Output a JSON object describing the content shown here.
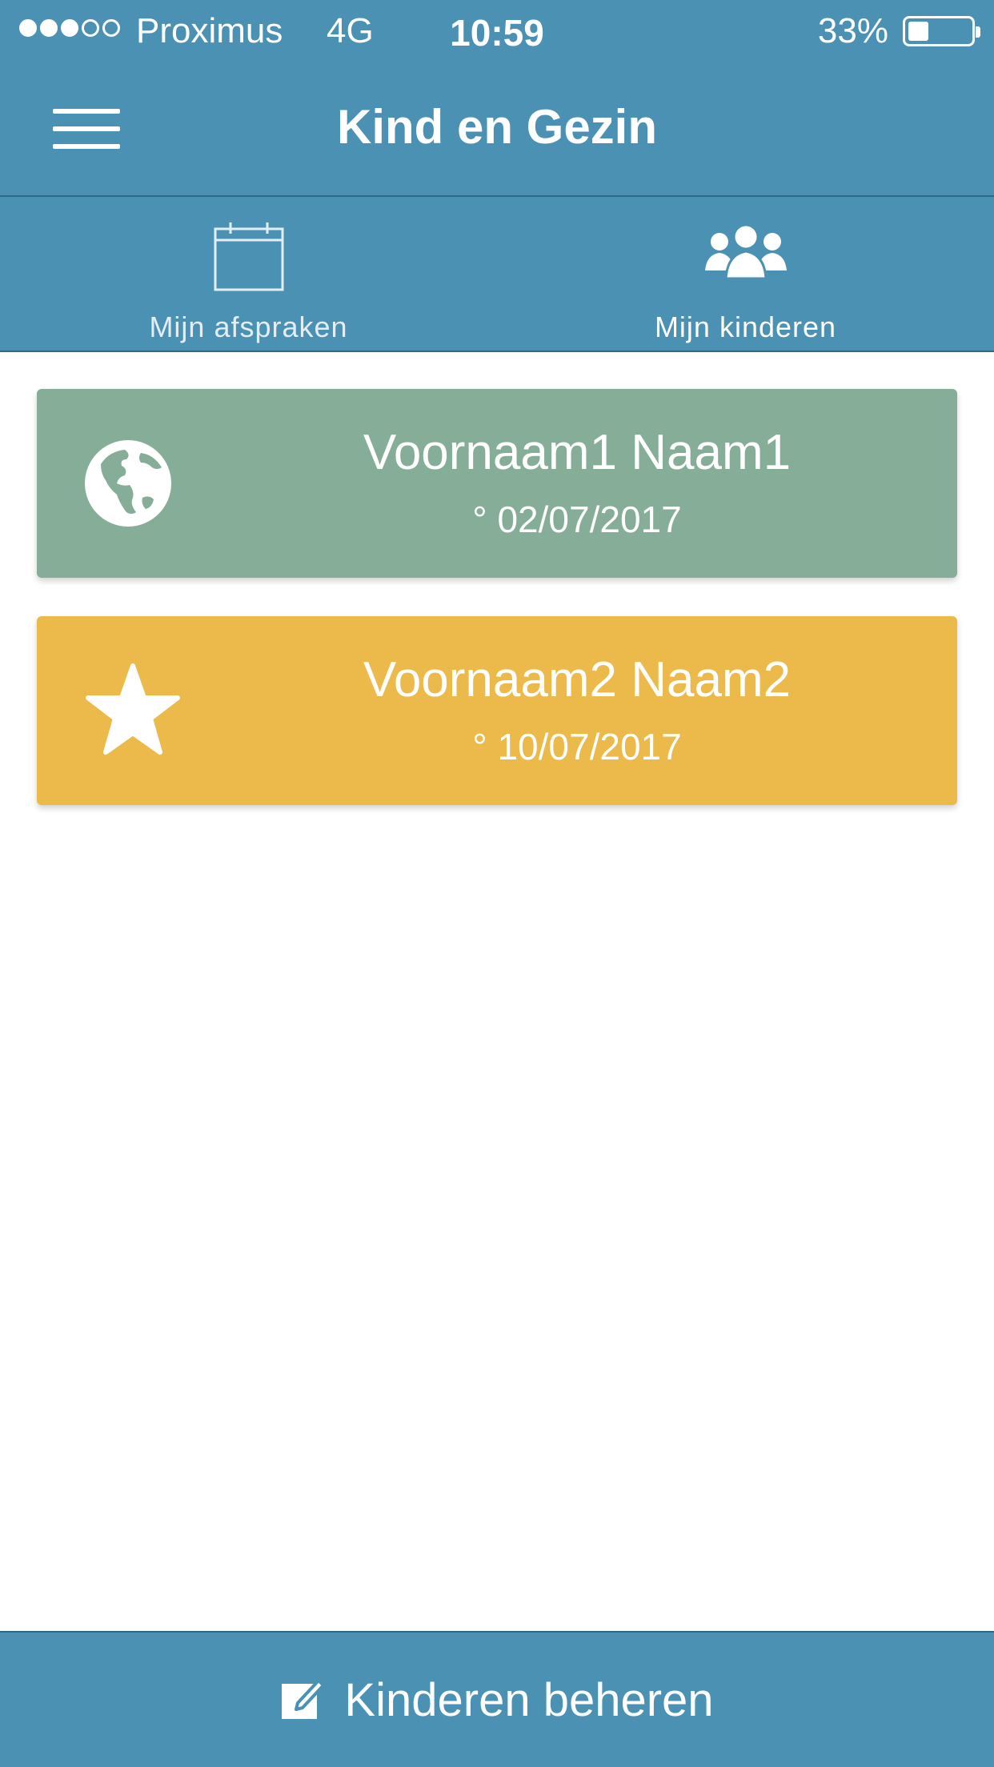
{
  "status_bar": {
    "signal_dots_filled": 3,
    "signal_dots_total": 5,
    "carrier": "Proximus",
    "network": "4G",
    "time": "10:59",
    "battery_percent": "33%",
    "battery_level": 0.33
  },
  "header": {
    "menu_icon": "hamburger-menu-icon",
    "title": "Kind en Gezin"
  },
  "tabs": [
    {
      "label": "Mijn afspraken",
      "icon": "calendar-icon",
      "active": false
    },
    {
      "label": "Mijn kinderen",
      "icon": "people-icon",
      "active": true
    }
  ],
  "children": [
    {
      "name": "Voornaam1 Naam1",
      "birth": "° 02/07/2017",
      "icon": "globe-icon",
      "color": "#86ad97"
    },
    {
      "name": "Voornaam2 Naam2",
      "birth": "° 10/07/2017",
      "icon": "star-icon",
      "color": "#ebba4b"
    }
  ],
  "footer": {
    "label": "Kinderen beheren",
    "icon": "edit-icon"
  },
  "colors": {
    "primary": "#4a91b3",
    "primary_dark": "#2e6a86",
    "text_on_primary": "#ffffff"
  }
}
